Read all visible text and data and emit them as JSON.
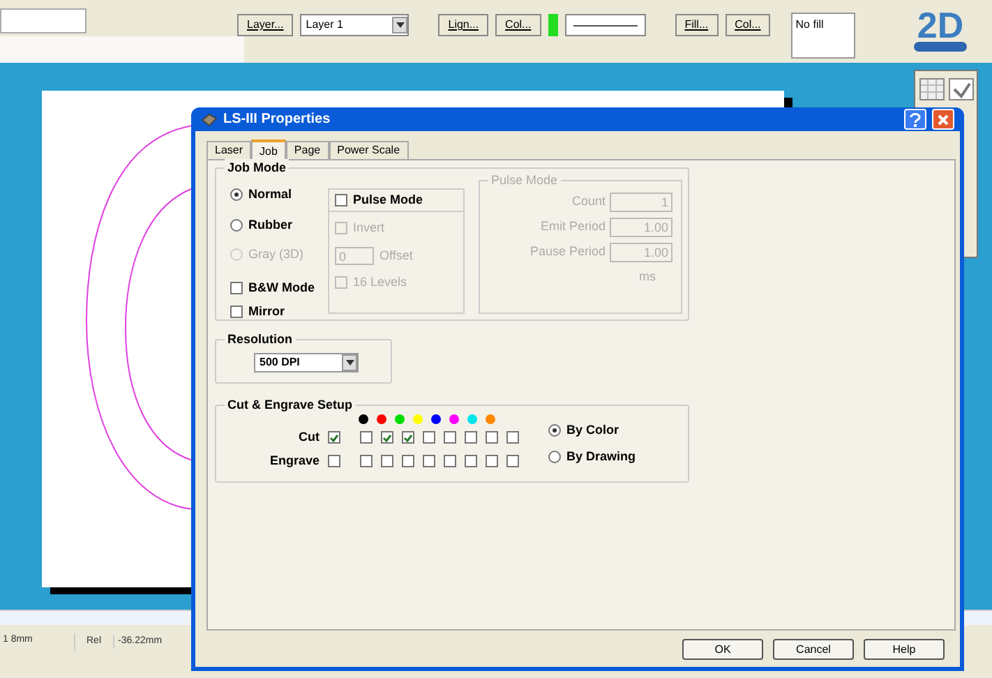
{
  "toolbar": {
    "items": [
      {
        "kind": "button",
        "label": "Layer..."
      },
      {
        "kind": "combo",
        "label": "Layer 1"
      },
      {
        "kind": "button",
        "label": "Lign..."
      },
      {
        "kind": "button",
        "label": "Col..."
      },
      {
        "kind": "swatch",
        "color": "#22dd22"
      },
      {
        "kind": "line"
      },
      {
        "kind": "button",
        "label": "Fill..."
      },
      {
        "kind": "button",
        "label": "Col..."
      },
      {
        "kind": "field",
        "label": "No fill"
      }
    ]
  },
  "logo": {
    "text": "2D"
  },
  "status_bar": {
    "position": "1 8mm",
    "label": "Rel",
    "value": "-36.22mm"
  },
  "dialog": {
    "title": "LS-III Properties",
    "tabs": [
      {
        "label": "Laser",
        "selected": false
      },
      {
        "label": "Job",
        "selected": true
      },
      {
        "label": "Page",
        "selected": false
      },
      {
        "label": "Power Scale",
        "selected": false
      }
    ],
    "job_mode": {
      "title": "Job Mode",
      "radios": [
        {
          "label": "Normal",
          "selected": true,
          "disabled": false
        },
        {
          "label": "Rubber",
          "selected": false,
          "disabled": false
        },
        {
          "label": "Gray (3D)",
          "selected": false,
          "disabled": true
        }
      ],
      "checkboxes": [
        {
          "label": "B&W Mode",
          "checked": false,
          "disabled": false
        },
        {
          "label": "Mirror",
          "checked": false,
          "disabled": false
        }
      ],
      "pulse": {
        "label": "Pulse Mode",
        "checked": false,
        "options": [
          {
            "kind": "checkbox",
            "label": "Invert",
            "checked": false,
            "disabled": true
          },
          {
            "kind": "input",
            "value": "0",
            "label": "Offset",
            "disabled": true
          },
          {
            "kind": "checkbox",
            "label": "16 Levels",
            "checked": false,
            "disabled": true
          }
        ]
      }
    },
    "pulse_mode": {
      "title": "Pulse Mode",
      "disabled": true,
      "fields": [
        {
          "label": "Count",
          "value": "1"
        },
        {
          "label": "Emit Period",
          "value": "1.00"
        },
        {
          "label": "Pause Period",
          "value": "1.00"
        }
      ],
      "unit": "ms"
    },
    "resolution": {
      "title": "Resolution",
      "value": "500 DPI"
    },
    "cut_engrave": {
      "title": "Cut & Engrave Setup",
      "colors": [
        {
          "color": "#000000"
        },
        {
          "color": "#ff0000"
        },
        {
          "color": "#00dd00"
        },
        {
          "color": "#ffff00"
        },
        {
          "color": "#0000ff"
        },
        {
          "color": "#ff00ff"
        },
        {
          "color": "#00e5ee"
        },
        {
          "color": "#ff8800"
        }
      ],
      "rows": [
        {
          "label": "Cut",
          "checked": true,
          "colors": [
            false,
            true,
            true,
            false,
            false,
            false,
            false,
            false
          ]
        },
        {
          "label": "Engrave",
          "checked": false,
          "colors": [
            false,
            false,
            false,
            false,
            false,
            false,
            false,
            false
          ]
        }
      ],
      "modes": [
        {
          "label": "By Color",
          "selected": true
        },
        {
          "label": "By Drawing",
          "selected": false
        }
      ]
    },
    "buttons": [
      "OK",
      "Cancel",
      "Help"
    ]
  }
}
